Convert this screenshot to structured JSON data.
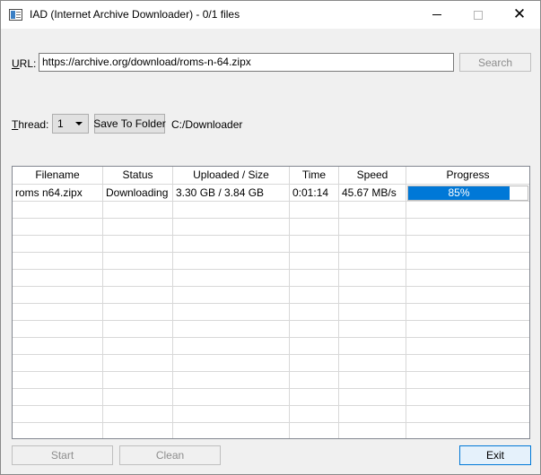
{
  "window": {
    "title": "IAD (Internet Archive Downloader) - 0/1 files",
    "close_glyph": "✕"
  },
  "url": {
    "label_u": "U",
    "label_rest": "RL:",
    "value": "https://archive.org/download/roms-n-64.zipx"
  },
  "search_button": "Search",
  "thread": {
    "label_u": "T",
    "label_rest": "hread:",
    "value": "1"
  },
  "save_button": "Save To Folder",
  "save_path": "C:/Downloader",
  "table": {
    "columns": [
      "Filename",
      "Status",
      "Uploaded / Size",
      "Time",
      "Speed",
      "Progress"
    ],
    "rows": [
      {
        "filename": "roms n64.zipx",
        "status": "Downloading",
        "uploaded_size": "3.30 GB / 3.84 GB",
        "time": "0:01:14",
        "speed": "45.67 MB/s",
        "progress_text": "85%",
        "progress_value": 0.85
      }
    ]
  },
  "buttons": {
    "start": "Start",
    "clean": "Clean",
    "exit": "Exit"
  },
  "colors": {
    "accent": "#0078d7"
  },
  "icons": [
    "app-icon",
    "minimize-icon",
    "maximize-icon",
    "close-icon",
    "chevron-down-icon"
  ]
}
